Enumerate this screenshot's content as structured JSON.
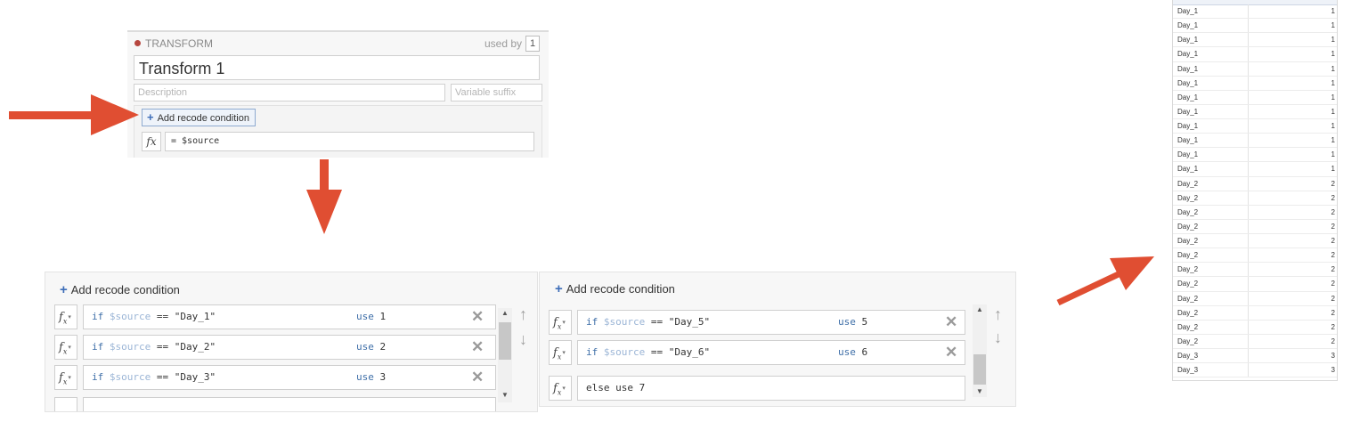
{
  "transform_panel": {
    "header": "TRANSFORM",
    "used_by_label": "used by",
    "used_by_count": "1",
    "name": "Transform 1",
    "description_placeholder": "Description",
    "suffix_placeholder": "Variable suffix",
    "add_condition_label": "Add recode condition",
    "fx_label": "fx",
    "expression": "= $source"
  },
  "recode_left": {
    "add_condition_label": "Add recode condition",
    "conditions": [
      {
        "if": "if",
        "var": "$source",
        "op": "==",
        "value": "\"Day_1\"",
        "use": "use",
        "result": "1"
      },
      {
        "if": "if",
        "var": "$source",
        "op": "==",
        "value": "\"Day_2\"",
        "use": "use",
        "result": "2"
      },
      {
        "if": "if",
        "var": "$source",
        "op": "==",
        "value": "\"Day_3\"",
        "use": "use",
        "result": "3"
      }
    ]
  },
  "recode_right": {
    "add_condition_label": "Add recode condition",
    "conditions": [
      {
        "if": "if",
        "var": "$source",
        "op": "==",
        "value": "\"Day_5\"",
        "use": "use",
        "result": "5"
      },
      {
        "if": "if",
        "var": "$source",
        "op": "==",
        "value": "\"Day_6\"",
        "use": "use",
        "result": "6"
      }
    ],
    "else_label": "else use 7"
  },
  "colors": {
    "arrow": "#e04e32",
    "accent": "#3f6fa8",
    "transform_dot": "#b7473f"
  },
  "icons": {
    "add": "plus-icon",
    "remove": "close-icon",
    "move_up": "arrow-up-icon",
    "move_down": "arrow-down-icon",
    "annotation_arrows": "arrow-icon"
  },
  "table": {
    "rows": [
      {
        "day": "Day_1",
        "value": "1"
      },
      {
        "day": "Day_1",
        "value": "1"
      },
      {
        "day": "Day_1",
        "value": "1"
      },
      {
        "day": "Day_1",
        "value": "1"
      },
      {
        "day": "Day_1",
        "value": "1"
      },
      {
        "day": "Day_1",
        "value": "1"
      },
      {
        "day": "Day_1",
        "value": "1"
      },
      {
        "day": "Day_1",
        "value": "1"
      },
      {
        "day": "Day_1",
        "value": "1"
      },
      {
        "day": "Day_1",
        "value": "1"
      },
      {
        "day": "Day_1",
        "value": "1"
      },
      {
        "day": "Day_1",
        "value": "1"
      },
      {
        "day": "Day_2",
        "value": "2"
      },
      {
        "day": "Day_2",
        "value": "2"
      },
      {
        "day": "Day_2",
        "value": "2"
      },
      {
        "day": "Day_2",
        "value": "2"
      },
      {
        "day": "Day_2",
        "value": "2"
      },
      {
        "day": "Day_2",
        "value": "2"
      },
      {
        "day": "Day_2",
        "value": "2"
      },
      {
        "day": "Day_2",
        "value": "2"
      },
      {
        "day": "Day_2",
        "value": "2"
      },
      {
        "day": "Day_2",
        "value": "2"
      },
      {
        "day": "Day_2",
        "value": "2"
      },
      {
        "day": "Day_2",
        "value": "2"
      },
      {
        "day": "Day_3",
        "value": "3"
      },
      {
        "day": "Day_3",
        "value": "3"
      }
    ]
  }
}
